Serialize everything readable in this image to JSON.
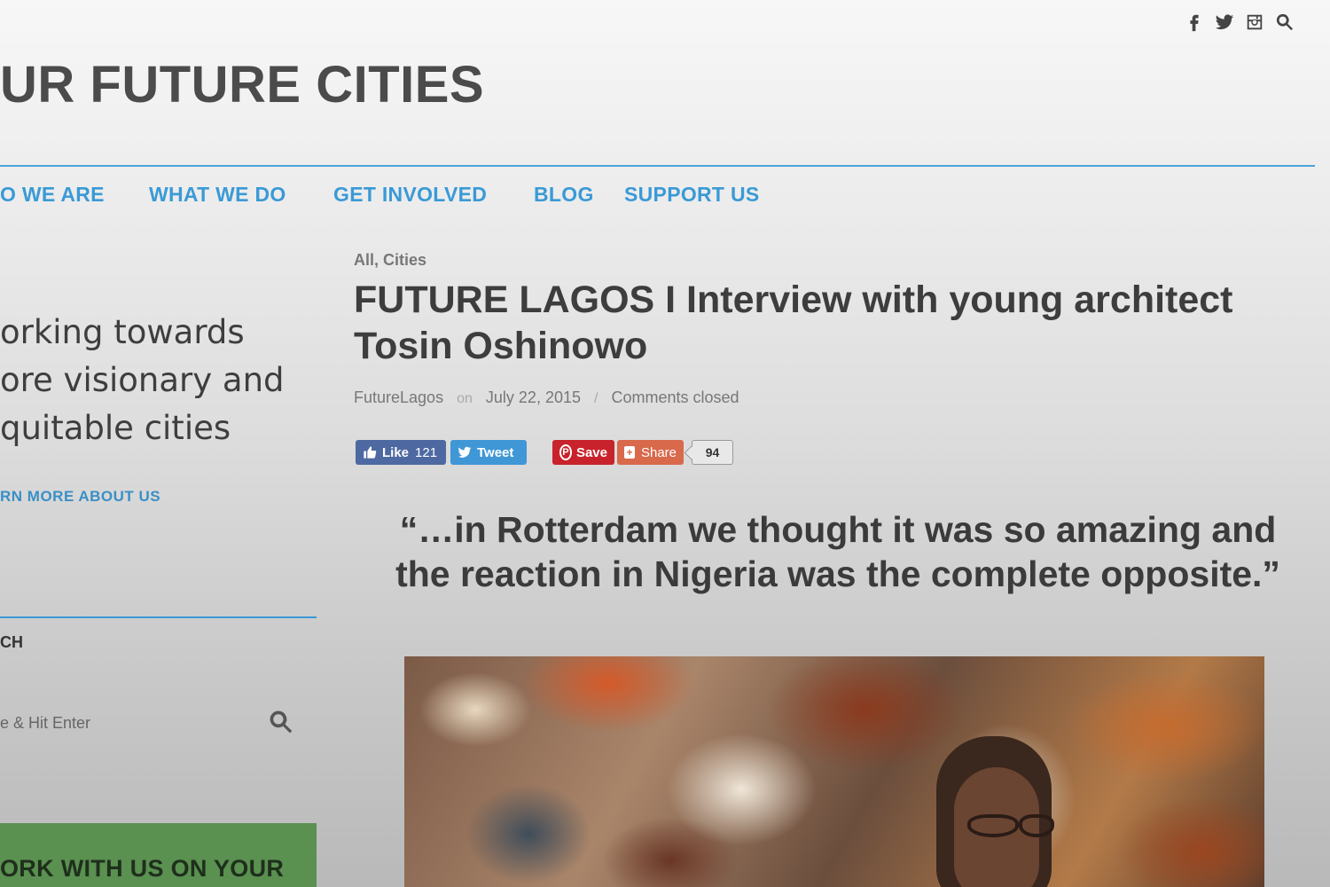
{
  "site": {
    "title": "UR FUTURE CITIES"
  },
  "social": [
    {
      "icon": "facebook-icon"
    },
    {
      "icon": "twitter-icon"
    },
    {
      "icon": "instagram-icon"
    },
    {
      "icon": "search-icon"
    }
  ],
  "nav": {
    "items": [
      {
        "label": "O WE ARE"
      },
      {
        "label": "WHAT WE DO"
      },
      {
        "label": "GET INVOLVED"
      },
      {
        "label": "BLOG"
      },
      {
        "label": "SUPPORT US"
      }
    ]
  },
  "sidebar": {
    "tagline": [
      "orking towards",
      "ore visionary and",
      "quitable cities"
    ],
    "learn_more": "RN MORE ABOUT US",
    "search_label": "CH",
    "search_placeholder": "e & Hit Enter",
    "cta": "ORK WITH US ON YOUR"
  },
  "article": {
    "categories": [
      "All",
      "Cities"
    ],
    "category_separator": ",",
    "headline": "FUTURE LAGOS I Interview with young architect Tosin Oshinowo",
    "author": "FutureLagos",
    "on_word": "on",
    "date": "July 22, 2015",
    "divider": "/",
    "comments": "Comments closed",
    "quote": "“…in Rotterdam we thought it was so amazing and the reaction in Nigeria was the complete opposite.”"
  },
  "share": {
    "like_label": "Like",
    "like_count": "121",
    "tweet_label": "Tweet",
    "save_label": "Save",
    "share_label": "Share",
    "share_count": "94"
  },
  "colors": {
    "accent": "#3a9ad6",
    "facebook": "#4e69a2",
    "twitter": "#3f97d6",
    "pinterest": "#c8232c",
    "share": "#d9694b",
    "cta_green": "#5a9050"
  }
}
